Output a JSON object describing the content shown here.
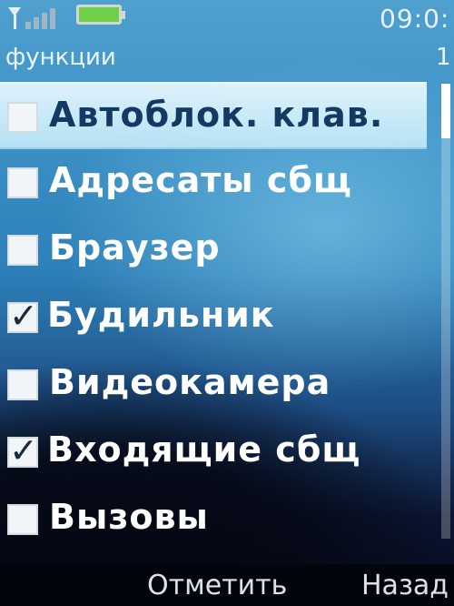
{
  "status_bar": {
    "signal_icon": "signal-strength-icon",
    "battery_icon": "battery-icon",
    "time": "09:0:"
  },
  "header": {
    "title": "функции",
    "page_number": "1"
  },
  "list": {
    "items": [
      {
        "label": "Автоблок. клав.",
        "checked": false,
        "selected": true
      },
      {
        "label": "Адресаты сбщ",
        "checked": false,
        "selected": false
      },
      {
        "label": "Браузер",
        "checked": false,
        "selected": false
      },
      {
        "label": "Будильник",
        "checked": true,
        "selected": false
      },
      {
        "label": "Видеокамера",
        "checked": false,
        "selected": false
      },
      {
        "label": "Входящие сбщ",
        "checked": true,
        "selected": false
      },
      {
        "label": "Вызовы",
        "checked": false,
        "selected": false
      }
    ]
  },
  "softkeys": {
    "left": "Отметить",
    "right": "Назад"
  },
  "colors": {
    "background_top": "#4fa0cf",
    "background_bottom": "#070b1c",
    "highlight": "#dff5fd",
    "selected_text": "#143a63",
    "battery_fill": "#6fce4a"
  }
}
